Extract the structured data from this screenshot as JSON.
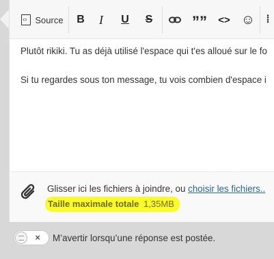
{
  "toolbar": {
    "source_label": "Source",
    "bold_label": "B",
    "italic_label": "I",
    "underline_label": "U",
    "strike_label": "S",
    "quote_label": "””",
    "code_label": "<>",
    "emoji_label": "☺",
    "more_label": "⁞"
  },
  "content": {
    "paragraphs": [
      "Plutôt rikiki. Tu as déjà utilisé l'espace qui t'es alloué sur le fo",
      "Si tu regardes sous ton message, tu vois combien d'espace i"
    ]
  },
  "attachments": {
    "drop_text": "Glisser ici les fichiers à joindre, ou ",
    "choose_link": "choisir les fichiers..",
    "max_size_label": "Taille maximale totale",
    "max_size_value": "1,35MB",
    "highlight_color": "#fbfb2a"
  },
  "notify": {
    "toggle_off_symbol": "×",
    "label": "M’avertir lorsqu’une réponse est postée."
  }
}
